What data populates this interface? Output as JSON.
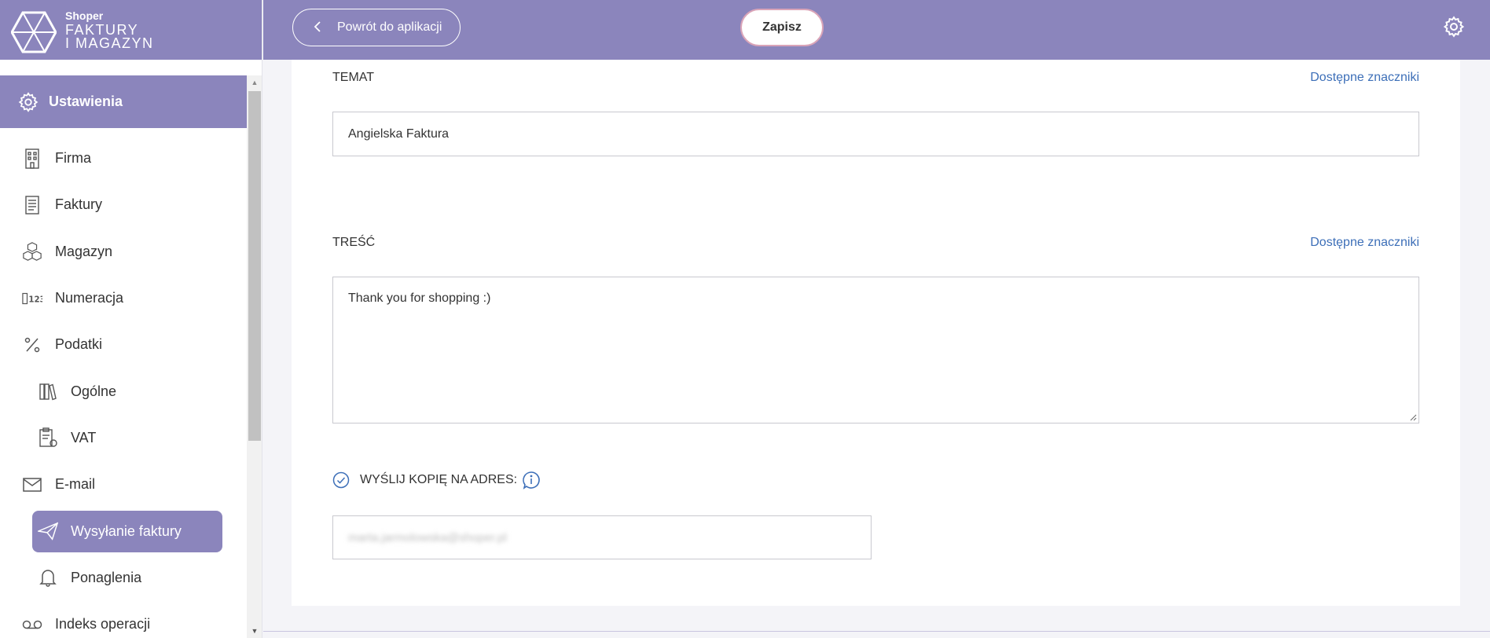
{
  "brand": {
    "small": "Shoper",
    "line1": "FAKTURY",
    "line2": "I MAGAZYN"
  },
  "sidebar": {
    "header": "Ustawienia",
    "items": [
      {
        "label": "Firma",
        "icon": "building-icon"
      },
      {
        "label": "Faktury",
        "icon": "document-icon"
      },
      {
        "label": "Magazyn",
        "icon": "boxes-icon"
      },
      {
        "label": "Numeracja",
        "icon": "numbering-icon"
      },
      {
        "label": "Podatki",
        "icon": "percent-icon"
      },
      {
        "label": "Ogólne",
        "icon": "book-icon"
      },
      {
        "label": "VAT",
        "icon": "clipboard-icon"
      },
      {
        "label": "E-mail",
        "icon": "envelope-icon"
      },
      {
        "label": "Wysyłanie faktury",
        "icon": "paper-plane-icon"
      },
      {
        "label": "Ponaglenia",
        "icon": "bell-icon"
      },
      {
        "label": "Indeks operacji",
        "icon": "voicemail-icon"
      }
    ]
  },
  "topbar": {
    "back_label": "Powrót do aplikacji",
    "save_label": "Zapisz"
  },
  "form": {
    "subject_label": "TEMAT",
    "subject_link": "Dostępne znaczniki",
    "subject_value": "Angielska Faktura",
    "body_label": "TREŚĆ",
    "body_link": "Dostępne znaczniki",
    "body_value": "Thank you for shopping :)",
    "copy_label": "WYŚLIJ KOPIĘ NA ADRES:",
    "copy_email": "marta.jarmolowska@shoper.pl"
  },
  "colors": {
    "accent": "#8b85bc",
    "link": "#3d6fb8"
  }
}
